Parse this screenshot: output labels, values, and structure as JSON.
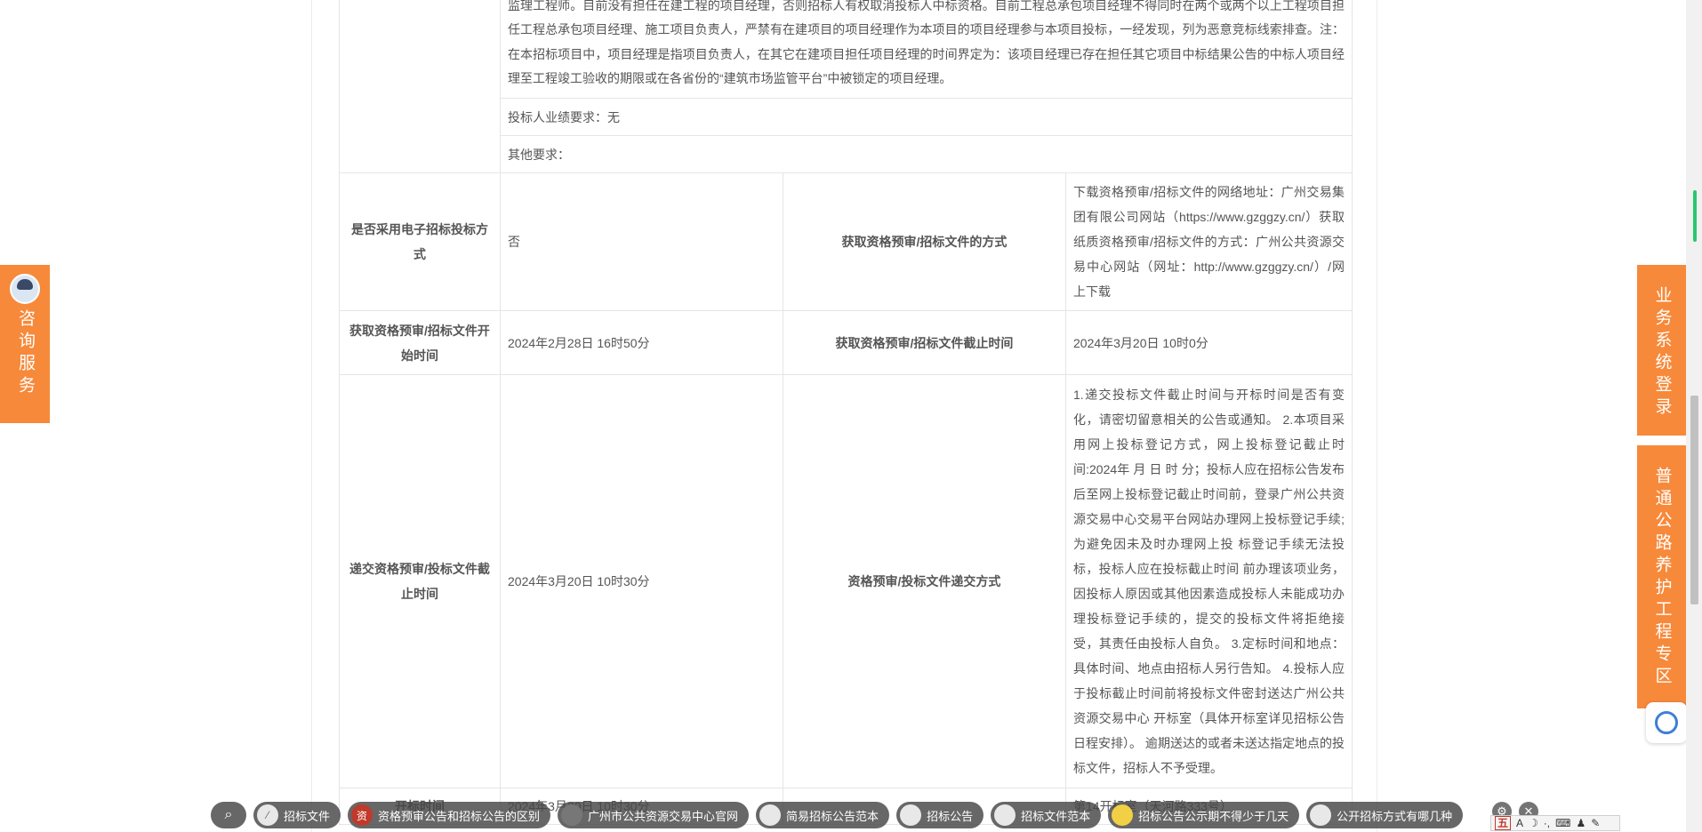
{
  "table": {
    "top_paragraph": "监理工程师。目前没有担任在建工程的项目经理，否则招标人有权取消投标人中标资格。目前工程总承包项目经理不得同时在两个或两个以上工程项目担任工程总承包项目经理、施工项目负责人，严禁有在建项目的项目经理作为本项目的项目经理参与本项目投标，一经发现，列为恶意竞标线索排查。注：在本招标项目中，项目经理是指项目负责人，在其它在建项目担任项目经理的时间界定为：该项目经理已存在担任其它项目中标结果公告的中标人项目经理至工程竣工验收的期限或在各省份的“建筑市场监管平台”中被锁定的项目经理。",
    "performance_req": "投标人业绩要求：无",
    "other_req": "其他要求：",
    "r1_label": "是否采用电子招标投标方式",
    "r1_value": "否",
    "r1_label2": "获取资格预审/招标文件的方式",
    "r1_value2": "下载资格预审/招标文件的网络地址：广州交易集团有限公司网站（https://www.gzggzy.cn/）获取纸质资格预审/招标文件的方式：广州公共资源交易中心网站（网址：http://www.gzggzy.cn/）/网上下载",
    "r2_label": "获取资格预审/招标文件开始时间",
    "r2_value": "2024年2月28日 16时50分",
    "r2_label2": "获取资格预审/招标文件截止时间",
    "r2_value2": "2024年3月20日 10时0分",
    "r3_label": "递交资格预审/投标文件截止时间",
    "r3_value": "2024年3月20日 10时30分",
    "r3_label2": "资格预审/投标文件递交方式",
    "r3_value2": "1.递交投标文件截止时间与开标时间是否有变化，请密切留意相关的公告或通知。 2.本项目采用网上投标登记方式，网上投标登记截止时间:2024年 月 日 时 分；投标人应在招标公告发布后至网上投标登记截止时间前，登录广州公共资源交易中心交易平台网站办理网上投标登记手续;为避免因未及时办理网上投 标登记手续无法投标，投标人应在投标截止时间 前办理该项业务，因投标人原因或其他因素造成投标人未能成功办理投标登记手续的，提交的投标文件将拒绝接受，其责任由投标人自负。 3.定标时间和地点：具体时间、地点由招标人另行告知。 4.投标人应于投标截止时间前将投标文件密封送达广州公共资源交易中心 开标室（具体开标室详见招标公告日程安排）。 逾期送达的或者未送达指定地点的投标文件，招标人不予受理。",
    "r4_label": "开标时间",
    "r4_value": "2024年3月20日 10时30分",
    "r4_value2": "第14开标室（天河路333号）"
  },
  "left_float": {
    "label": "咨询服务",
    "icon": "customer-service-avatar-icon"
  },
  "right_float": {
    "btn1": "业务系统登录",
    "btn2": "普通公路养护工程专区",
    "icon": "refresh-chat-icon"
  },
  "bottom_bar": {
    "items": [
      "招标文件",
      "资格预审公告和招标公告的区别",
      "广州市公共资源交易中心官网",
      "简易招标公告范本",
      "招标公告",
      "招标文件范本",
      "招标公告公示期不得少于几天",
      "公开招标方式有哪几种"
    ]
  },
  "ime": {
    "mode": "五"
  }
}
